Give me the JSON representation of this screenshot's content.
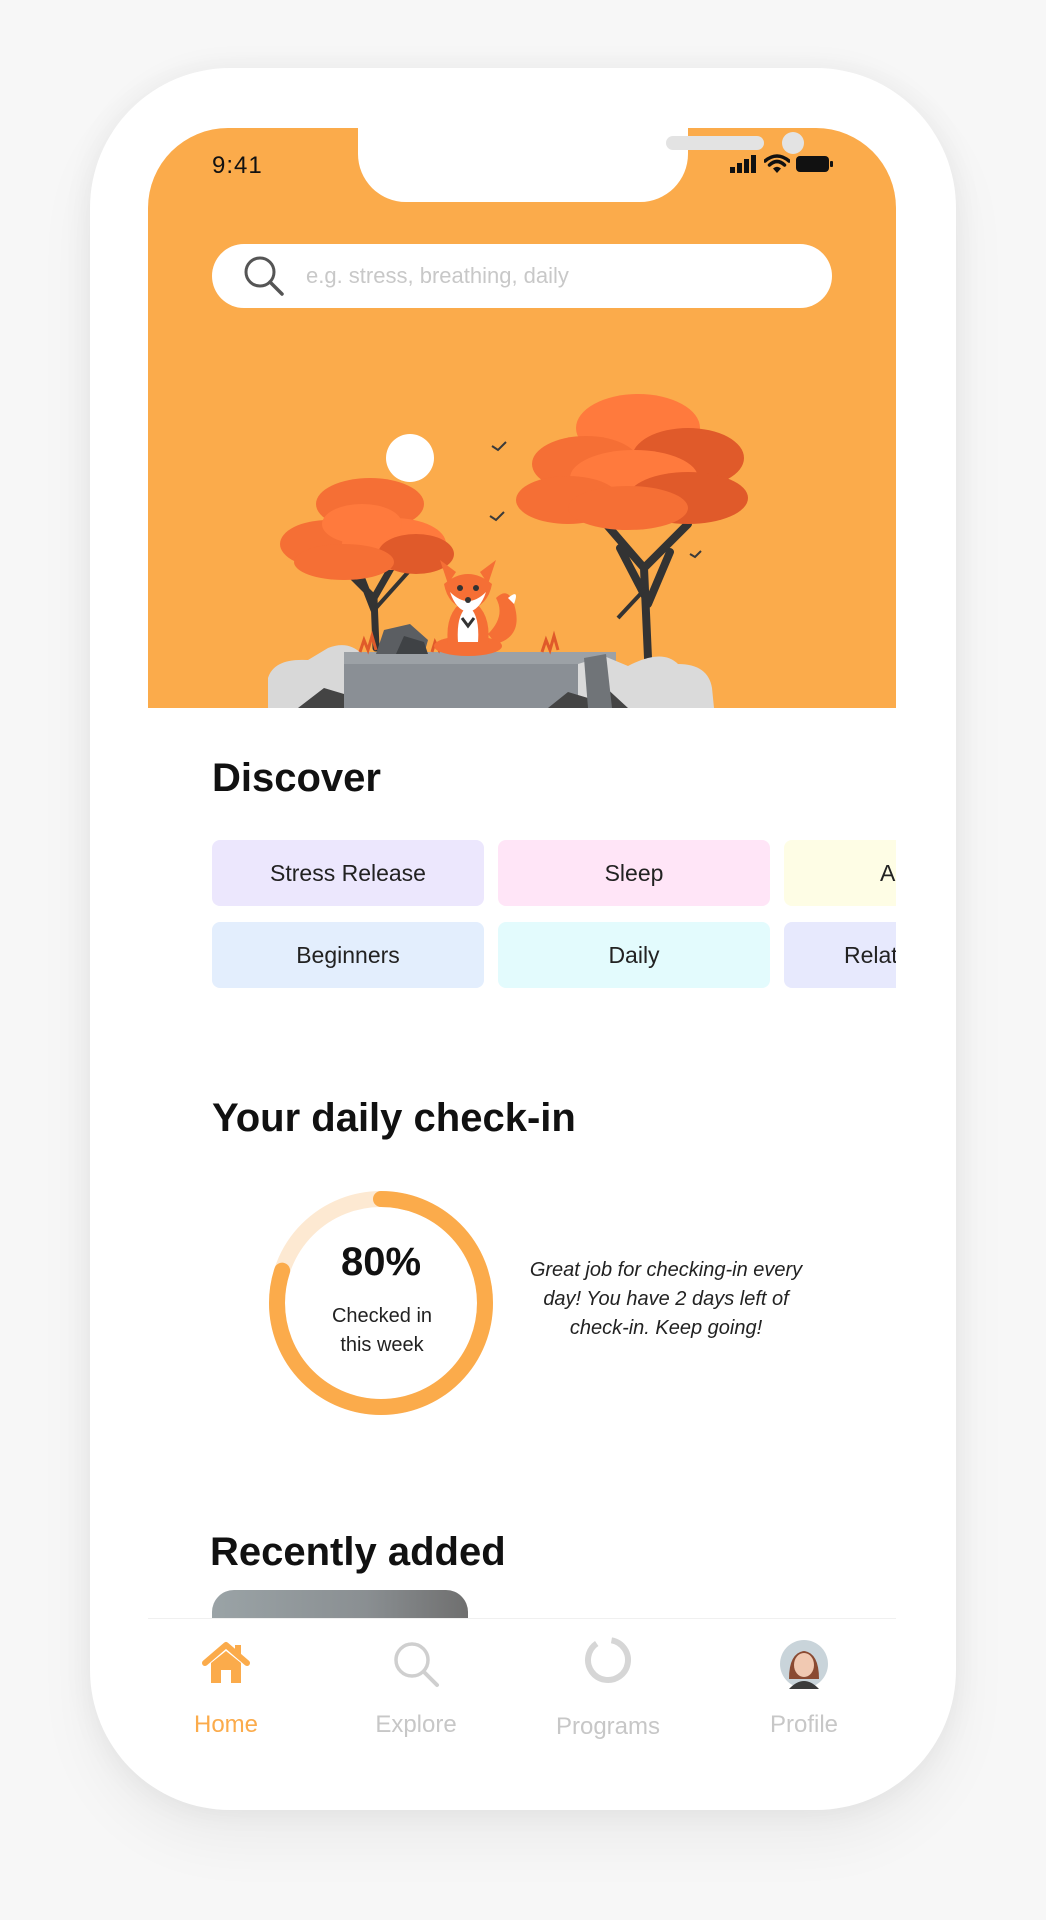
{
  "status_bar": {
    "time": "9:41"
  },
  "search": {
    "placeholder": "e.g. stress, breathing, daily",
    "icon": "search-icon"
  },
  "discover": {
    "title": "Discover",
    "chips": [
      {
        "label": "Stress Release",
        "color": "#ece7fd"
      },
      {
        "label": "Sleep",
        "color": "#ffe5f7"
      },
      {
        "label": "A",
        "color": "#fefde5"
      },
      {
        "label": "Beginners",
        "color": "#e3eefd"
      },
      {
        "label": "Daily",
        "color": "#e3fbfd"
      },
      {
        "label": "Relat",
        "color": "#e7e9fd"
      }
    ]
  },
  "checkin": {
    "title": "Your daily check-in",
    "percent_label": "80%",
    "progress": 0.8,
    "subtitle": "Checked in this week",
    "message": "Great job for checking-in every day! You have 2 days left of check-in. Keep going!"
  },
  "recent": {
    "title": "Recently added"
  },
  "tabbar": {
    "tabs": [
      {
        "label": "Home",
        "icon": "home-icon",
        "active": true
      },
      {
        "label": "Explore",
        "icon": "search-icon",
        "active": false
      },
      {
        "label": "Programs",
        "icon": "ring-icon",
        "active": false
      },
      {
        "label": "Profile",
        "icon": "avatar",
        "active": false
      }
    ]
  },
  "colors": {
    "accent": "#fbab4b",
    "ring_track": "#fde9d2",
    "inactive_tab": "#c7c7c7"
  }
}
